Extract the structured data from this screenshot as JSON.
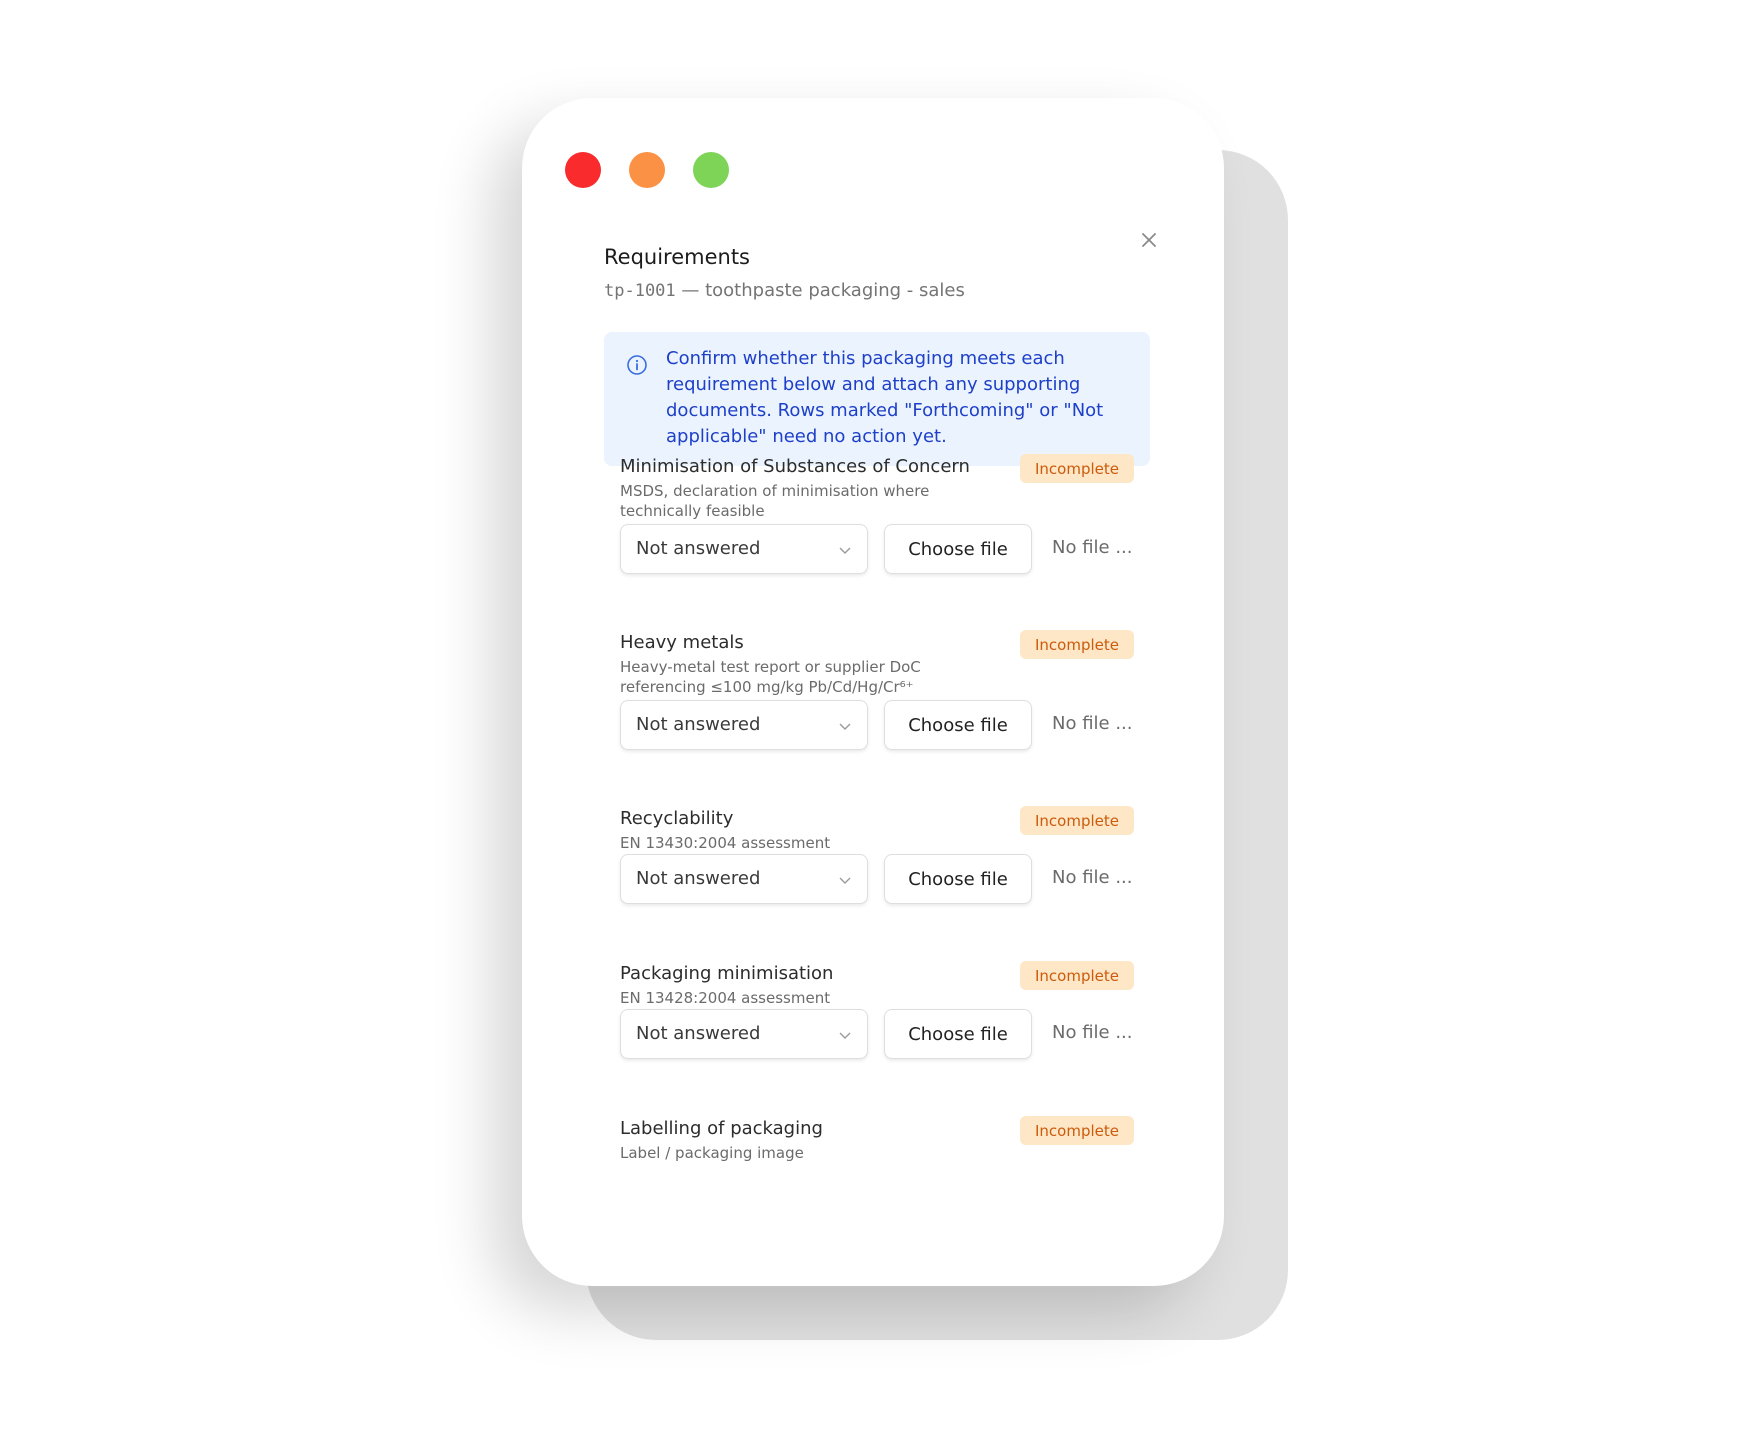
{
  "window": {
    "title": "Requirements",
    "subtitle_code": "tp-1001",
    "subtitle_rest": " — toothpaste packaging - sales",
    "close_icon": "close-icon"
  },
  "info": {
    "icon": "info-icon",
    "text": "Confirm whether this packaging meets each requirement below and attach any supporting documents. Rows marked \"Forthcoming\" or \"Not applicable\" need no action yet."
  },
  "colors": {
    "badge_bg": "#fde7c6",
    "badge_text": "#cc5b0d",
    "info_bg": "#ebf3fe",
    "info_text": "#1e40c8"
  },
  "requirements": [
    {
      "title": "Minimisation of Substances of Concern",
      "desc": "MSDS, declaration of minimisation where technically feasible",
      "status": "Incomplete",
      "answer": "Not answered",
      "choose_label": "Choose file",
      "file_status": "No file ..."
    },
    {
      "title": "Heavy metals",
      "desc": "Heavy-metal test report or supplier DoC referencing ≤100 mg/kg Pb/Cd/Hg/Cr⁶⁺",
      "status": "Incomplete",
      "answer": "Not answered",
      "choose_label": "Choose file",
      "file_status": "No file ..."
    },
    {
      "title": "Recyclability",
      "desc": "EN 13430:2004 assessment",
      "status": "Incomplete",
      "answer": "Not answered",
      "choose_label": "Choose file",
      "file_status": "No file ..."
    },
    {
      "title": "Packaging minimisation",
      "desc": "EN 13428:2004 assessment",
      "status": "Incomplete",
      "answer": "Not answered",
      "choose_label": "Choose file",
      "file_status": "No file ..."
    },
    {
      "title": "Labelling of packaging",
      "desc": "Label / packaging image",
      "status": "Incomplete"
    }
  ]
}
